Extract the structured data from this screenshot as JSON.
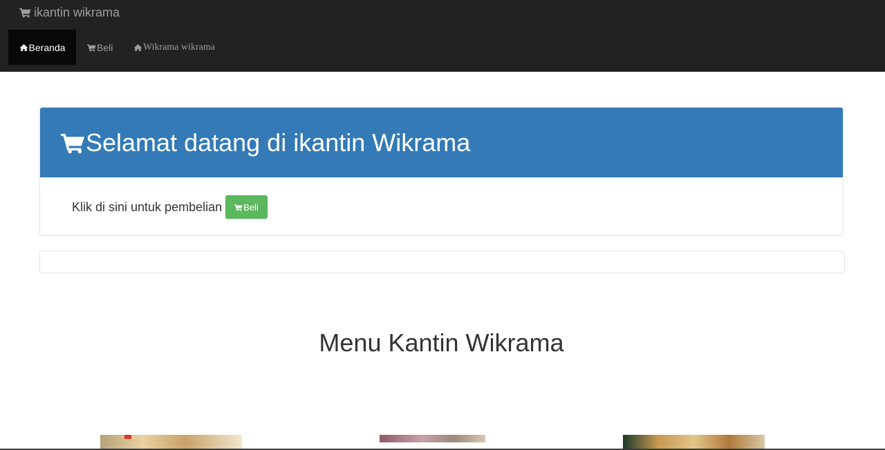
{
  "navbar": {
    "brand": "ikantin wikrama",
    "brand_icon": "cart-icon",
    "tabs": [
      {
        "label": "Beranda",
        "icon": "home-icon",
        "active": true
      },
      {
        "label": "Beli",
        "icon": "cart-icon",
        "active": false
      },
      {
        "label": "Wikrama wikrama",
        "icon": "home-icon",
        "active": false
      }
    ]
  },
  "panel": {
    "title": "Selamat datang di ikantin Wikrama",
    "title_icon": "cart-icon",
    "body_text": "Klik di sini untuk pembelian",
    "button_label": "Beli",
    "heading_color": "#337ab7",
    "button_color": "#5cb85c"
  },
  "menu": {
    "title": "Menu Kantin Wikrama"
  }
}
